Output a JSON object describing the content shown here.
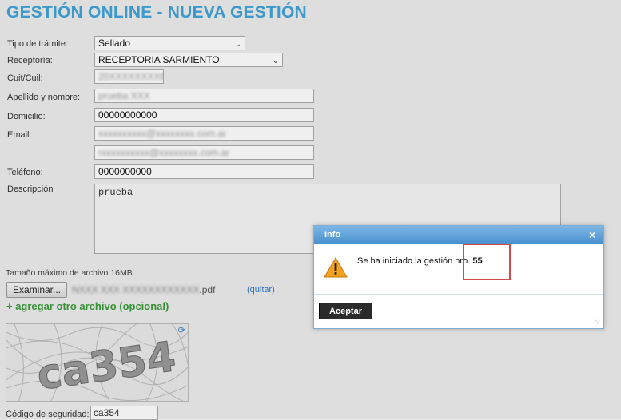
{
  "page": {
    "title": "GESTIÓN ONLINE - NUEVA GESTIÓN"
  },
  "form": {
    "tipo_label": "Tipo de trámite:",
    "tipo_value": "Sellado",
    "receptoria_label": "Receptoría:",
    "receptoria_value": "RECEPTORIA SARMIENTO",
    "cuit_label": "Cuit/Cuil:",
    "cuit_value": "20XXXXXXXX6",
    "apellido_label": "Apellido y nombre:",
    "apellido_value": "prueba XXX",
    "domicilio_label": "Domicilio:",
    "domicilio_value": "00000000000",
    "email_label": "Email:",
    "email_value": "xxxxxxxxxx@xxxxxxxx.com.ar",
    "email_confirm_value": "rxxxxxxxxxx@xxxxxxxx.com.ar",
    "telefono_label": "Teléfono:",
    "telefono_value": "0000000000",
    "descripcion_label": "Descripción",
    "descripcion_value": "prueba",
    "max_size_text": "Tamaño máximo de archivo 16MB",
    "file_button_label": "Examinar...",
    "file_name_hidden": "NXXX XXX XXXXXXXXXXXX",
    "file_ext": ".pdf",
    "quitar_link": "(quitar)",
    "add_file_link": "+ agregar otro archivo (opcional)",
    "captcha_text": "ca354",
    "captcha_reload_icon": "reload-icon",
    "security_label": "Código de seguridad:",
    "security_value": "ca354"
  },
  "dialog": {
    "title": "Info",
    "close_icon": "close-icon",
    "message": "Se ha iniciado la gestión nro.",
    "number": "55",
    "accept_label": "Aceptar"
  },
  "colors": {
    "title": "#3fa3d8",
    "dialog_header": "#4a91cf",
    "add_link": "#3a9a3a",
    "highlight": "#d24a4a"
  }
}
